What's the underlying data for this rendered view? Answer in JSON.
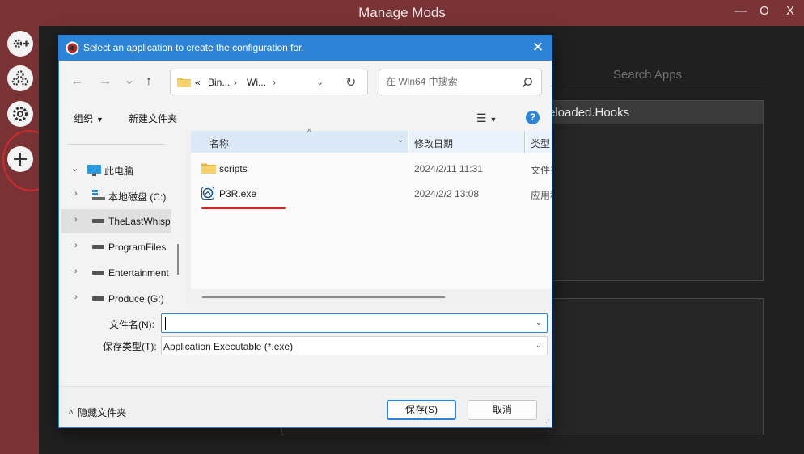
{
  "app": {
    "title": "Manage Mods",
    "controls": {
      "minimize": "—",
      "maximize": "O",
      "close": "X"
    },
    "search_placeholder": "Search Apps",
    "selected_app": "eloaded.Hooks",
    "sidebar_icons": [
      "gear-plus-icon",
      "gears-icon",
      "settings-icon",
      "add-icon"
    ]
  },
  "dialog": {
    "title": "Select an application to create the configuration for.",
    "close": "✕",
    "nav": {
      "back": "←",
      "forward": "→",
      "recent": "⌄",
      "up": "↑"
    },
    "address": {
      "prefix": "«",
      "segments": [
        "Bin...",
        "Wi..."
      ],
      "sep": "›"
    },
    "search_placeholder": "在 Win64 中搜索",
    "toolbar": {
      "organize": "组织",
      "new_folder": "新建文件夹",
      "help": "?"
    },
    "nav_pane": [
      {
        "label": "此电脑",
        "icon": "pc-icon",
        "expanded": true
      },
      {
        "label": "本地磁盘 (C:)",
        "icon": "windows-drive-icon"
      },
      {
        "label": "TheLastWhisper",
        "icon": "drive-icon",
        "selected": true
      },
      {
        "label": "ProgramFiles",
        "icon": "drive-icon"
      },
      {
        "label": "Entertainment",
        "icon": "drive-icon"
      },
      {
        "label": "Produce (G:)",
        "icon": "drive-icon"
      }
    ],
    "columns": {
      "name": "名称",
      "date": "修改日期",
      "type": "类型"
    },
    "files": [
      {
        "name": "scripts",
        "date": "2024/2/11 11:31",
        "type": "文件夹",
        "icon": "folder-icon"
      },
      {
        "name": "P3R.exe",
        "date": "2024/2/2 13:08",
        "type": "应用程序",
        "icon": "exe-icon"
      }
    ],
    "filename_label": "文件名(N):",
    "filename_value": "",
    "filetype_label": "保存类型(T):",
    "filetype_value": "Application Executable (*.exe)",
    "hide_folders": "隐藏文件夹",
    "save_button": "保存(S)",
    "cancel_button": "取消"
  },
  "colors": {
    "accent": "#2b84d8",
    "app_bar": "#7a3335",
    "annotation": "#d42222"
  }
}
